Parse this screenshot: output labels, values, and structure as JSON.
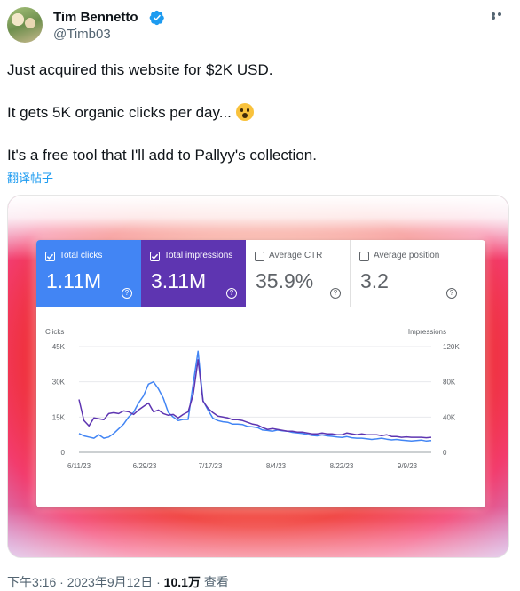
{
  "tweet": {
    "author_name": "Tim Bennetto",
    "handle": "@Timb03",
    "lines": [
      "Just acquired this website for $2K USD.",
      "It gets 5K organic clicks per day...",
      "It's a free tool that I'll add to Pallyy's collection."
    ],
    "emoji": "astonished-face",
    "translate_label": "翻译帖子",
    "time": "下午3:16",
    "date": "2023年9月12日",
    "views": "10.1万",
    "views_label": "查看",
    "sep": "·"
  },
  "metrics": [
    {
      "label": "Total clicks",
      "value": "1.11M",
      "checked": true,
      "color": "#4285f4"
    },
    {
      "label": "Total impressions",
      "value": "3.11M",
      "checked": true,
      "color": "#5e35b1"
    },
    {
      "label": "Average CTR",
      "value": "35.9%",
      "checked": false
    },
    {
      "label": "Average position",
      "value": "3.2",
      "checked": false
    }
  ],
  "chart_data": {
    "type": "line",
    "left_axis_label": "Clicks",
    "right_axis_label": "Impressions",
    "left_ticks": [
      "45K",
      "30K",
      "15K",
      "0"
    ],
    "right_ticks": [
      "120K",
      "80K",
      "40K",
      "0"
    ],
    "left_range": [
      0,
      45000
    ],
    "right_range": [
      0,
      120000
    ],
    "x_labels": [
      "6/11/23",
      "6/29/23",
      "7/17/23",
      "8/4/23",
      "8/22/23",
      "9/9/23"
    ],
    "grid": true,
    "series": [
      {
        "name": "Clicks",
        "axis": "left",
        "color": "#4285f4",
        "values": [
          8000,
          7000,
          6500,
          6000,
          7500,
          6000,
          6500,
          8000,
          10000,
          12000,
          15000,
          17000,
          21000,
          24000,
          29000,
          30000,
          27000,
          23000,
          17000,
          15000,
          13500,
          14000,
          14000,
          29000,
          43000,
          22000,
          18000,
          14500,
          13500,
          13000,
          12800,
          12000,
          12000,
          11800,
          11000,
          10800,
          10500,
          9500,
          9300,
          9000,
          9500,
          9200,
          9000,
          8500,
          8300,
          8000,
          7600,
          7200,
          7000,
          7400,
          7000,
          6800,
          6500,
          6300,
          6700,
          6200,
          6000,
          6000,
          5800,
          5500,
          5700,
          6000,
          5600,
          5300,
          5500,
          5200,
          5000,
          4800,
          5000,
          5200,
          4800,
          5000
        ]
      },
      {
        "name": "Impressions",
        "axis": "right",
        "color": "#5e35b1",
        "values": [
          60000,
          36000,
          30000,
          39000,
          38000,
          37000,
          44000,
          45000,
          44000,
          47000,
          46000,
          43000,
          48000,
          52000,
          56000,
          46000,
          48000,
          44000,
          42000,
          43000,
          39000,
          43000,
          46000,
          65000,
          105000,
          58000,
          50000,
          45000,
          41000,
          40000,
          39000,
          37000,
          37000,
          36000,
          34000,
          32000,
          31000,
          28000,
          26000,
          27000,
          26000,
          25000,
          24000,
          24000,
          23000,
          23000,
          22000,
          21000,
          21000,
          22000,
          21000,
          21000,
          20000,
          20000,
          22000,
          21000,
          20000,
          21000,
          20000,
          20000,
          20000,
          19000,
          20000,
          18000,
          18000,
          17000,
          17500,
          17000,
          17000,
          17000,
          16500,
          17000
        ]
      }
    ]
  }
}
